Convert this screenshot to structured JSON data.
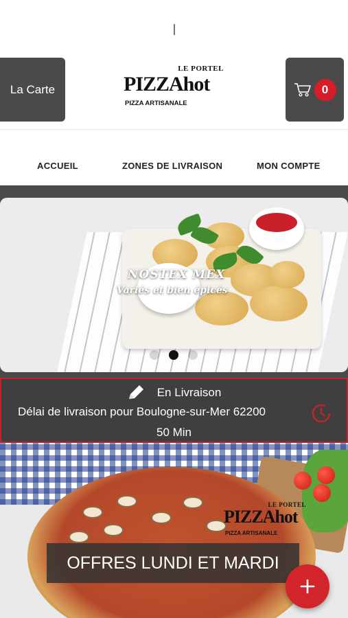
{
  "header": {
    "menu_label": "La Carte",
    "cart_count": "0",
    "logo": {
      "top_text": "LE PORTEL",
      "main_text": "PIZZAhot",
      "sub_text": "PIZZA ARTISANALE"
    }
  },
  "nav": {
    "items": [
      {
        "label": "ACCUEIL"
      },
      {
        "label": "ZONES DE LIVRAISON"
      },
      {
        "label": "MON COMPTE"
      }
    ]
  },
  "slider": {
    "title": "NOSTEX MEX",
    "subtitle": "Variés et bien épicés",
    "active_slide": 2,
    "slide_count": 3
  },
  "delivery": {
    "mode": "En Livraison",
    "delay_text": "Délai de livraison pour Boulogne-sur-Mer 62200",
    "duration": "50 Min"
  },
  "promo": {
    "banner": "OFFRES LUNDI ET MARDI",
    "logo": {
      "top_text": "LE PORTEL",
      "main_text": "PIZZAhot",
      "sub_text": "PIZZA ARTISANALE"
    }
  },
  "colors": {
    "accent_red": "#d71e28",
    "dark_gray": "#4a4a4a"
  },
  "icons": [
    "cart-icon",
    "pencil-icon",
    "clock-icon",
    "plus-icon"
  ]
}
